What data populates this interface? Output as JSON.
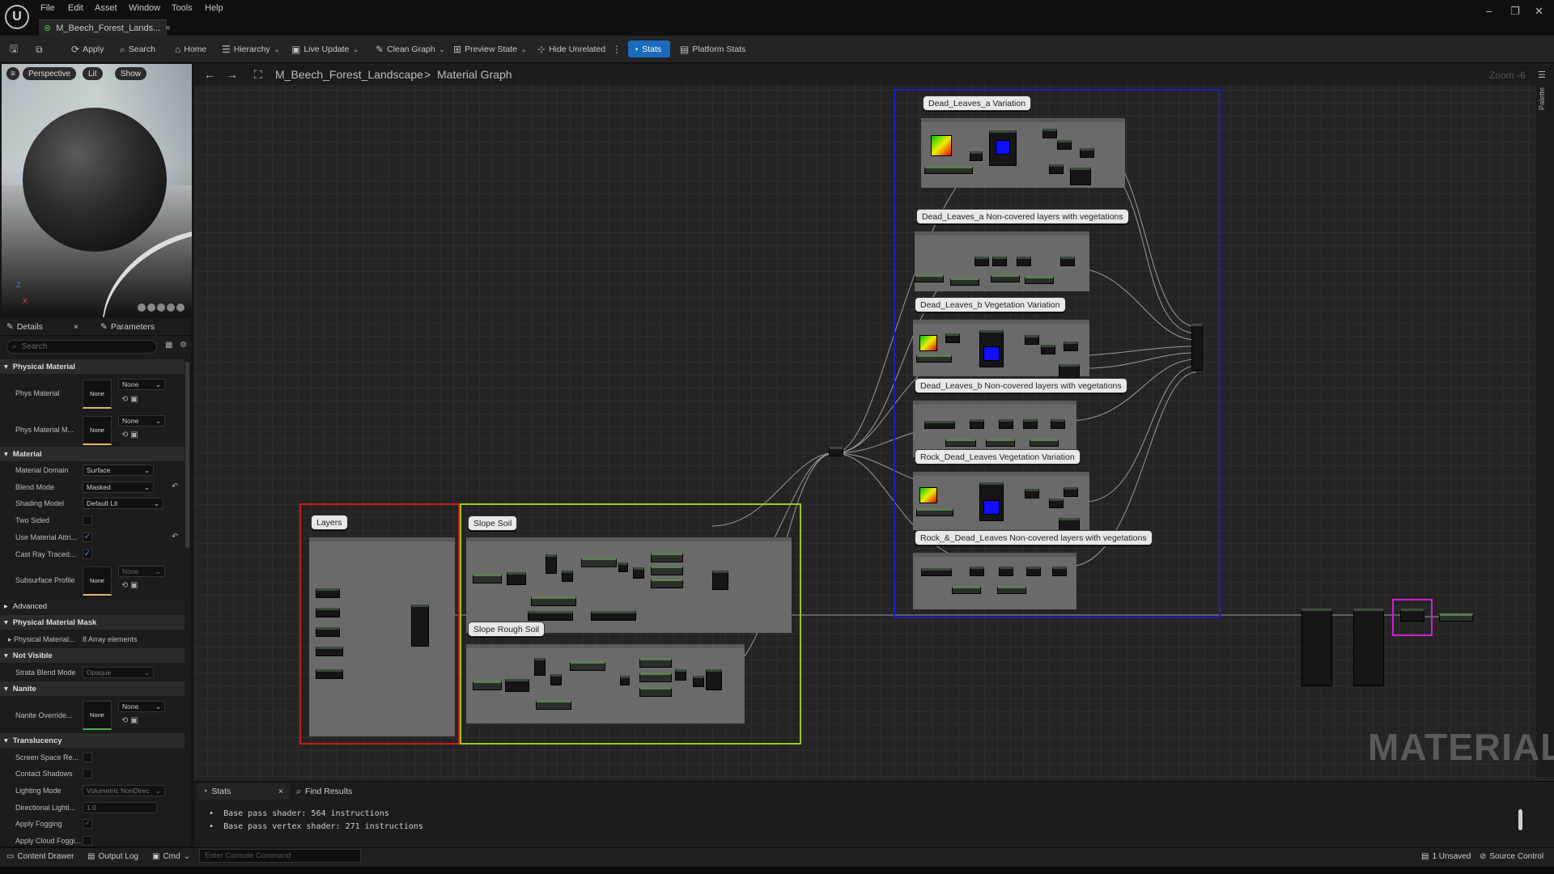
{
  "titlebar": {
    "menu": [
      "File",
      "Edit",
      "Asset",
      "Window",
      "Tools",
      "Help"
    ],
    "tab_title": "M_Beech_Forest_Lands...",
    "tab_close": "×",
    "window_controls": [
      "–",
      "❐",
      "✕"
    ]
  },
  "toolbar": {
    "apply": "Apply",
    "search": "Search",
    "home": "Home",
    "hierarchy": "Hierarchy",
    "live_update": "Live Update",
    "clean_graph": "Clean Graph",
    "preview_state": "Preview State",
    "hide_unrelated": "Hide Unrelated",
    "stats": "Stats",
    "platform_stats": "Platform Stats",
    "active_color": "#1a6bbd"
  },
  "viewport": {
    "perspective": "Perspective",
    "lit": "Lit",
    "show": "Show",
    "axis_z": "Z",
    "axis_x": "X"
  },
  "details": {
    "tabs": [
      "Details",
      "Parameters"
    ],
    "search_placeholder": "Search",
    "sections": {
      "physical_material": "Physical Material",
      "material": "Material",
      "advanced": "Advanced",
      "physical_material_mask": "Physical Material Mask",
      "not_visible": "Not Visible",
      "nanite": "Nanite",
      "translucency": "Translucency"
    },
    "props": {
      "phys_material": "Phys Material",
      "phys_material_m": "Phys Material M...",
      "material_domain": "Material Domain",
      "material_domain_val": "Surface",
      "blend_mode": "Blend Mode",
      "blend_mode_val": "Masked",
      "shading_model": "Shading Model",
      "shading_model_val": "Default Lit",
      "two_sided": "Two Sided",
      "use_material_attri": "Use Material Attri...",
      "cast_ray_traced": "Cast Ray Traced...",
      "subsurface_profile": "Subsurface Profile",
      "physical_material_arr": "Physical Material...",
      "array_elements": "8 Array elements",
      "strata_blend_mode": "Strata Blend Mode",
      "strata_blend_val": "Opaque",
      "nanite_override": "Nanite Override...",
      "screen_space_re": "Screen Space Re...",
      "contact_shadows": "Contact Shadows",
      "lighting_mode": "Lighting Mode",
      "lighting_mode_val": "Volumetric NonDirec",
      "directional_lighti": "Directional Lighti...",
      "directional_val": "1.0",
      "apply_fogging": "Apply Fogging",
      "apply_cloud_foggi": "Apply Cloud Foggi...",
      "none": "None"
    }
  },
  "graph": {
    "breadcrumb_root": "M_Beech_Forest_Landscape",
    "breadcrumb_sep": ">",
    "breadcrumb_current": "Material Graph",
    "zoom": "Zoom -6",
    "palette": "Palette",
    "watermark": "MATERIAL",
    "comments": {
      "dl_a_var": "Dead_Leaves_a Variation",
      "dl_a_noncov": "Dead_Leaves_a Non-covered layers with vegetations",
      "dl_b_var": "Dead_Leaves_b Vegetation Variation",
      "dl_b_noncov": "Dead_Leaves_b Non-covered layers with vegetations",
      "rock_var": "Rock_Dead_Leaves Vegetation Variation",
      "rock_noncov": "Rock_&_Dead_Leaves Non-covered layers with vegetations",
      "layers": "Layers",
      "slope_soil": "Slope Soil",
      "slope_rough_soil": "Slope Rough Soil"
    },
    "frame_colors": {
      "blue": "#1c1cc8",
      "red": "#c81c1c",
      "green": "#9bc81c",
      "magenta": "#d21cd2"
    }
  },
  "bottom_panel": {
    "tab_stats": "Stats",
    "tab_close": "×",
    "tab_find": "Find Results",
    "lines": [
      "Base pass shader: 564 instructions",
      "Base pass vertex shader: 271 instructions"
    ]
  },
  "statusbar": {
    "content_drawer": "Content Drawer",
    "output_log": "Output Log",
    "cmd": "Cmd",
    "console_placeholder": "Enter Console Command",
    "unsaved": "1 Unsaved",
    "source_control": "Source Control"
  }
}
